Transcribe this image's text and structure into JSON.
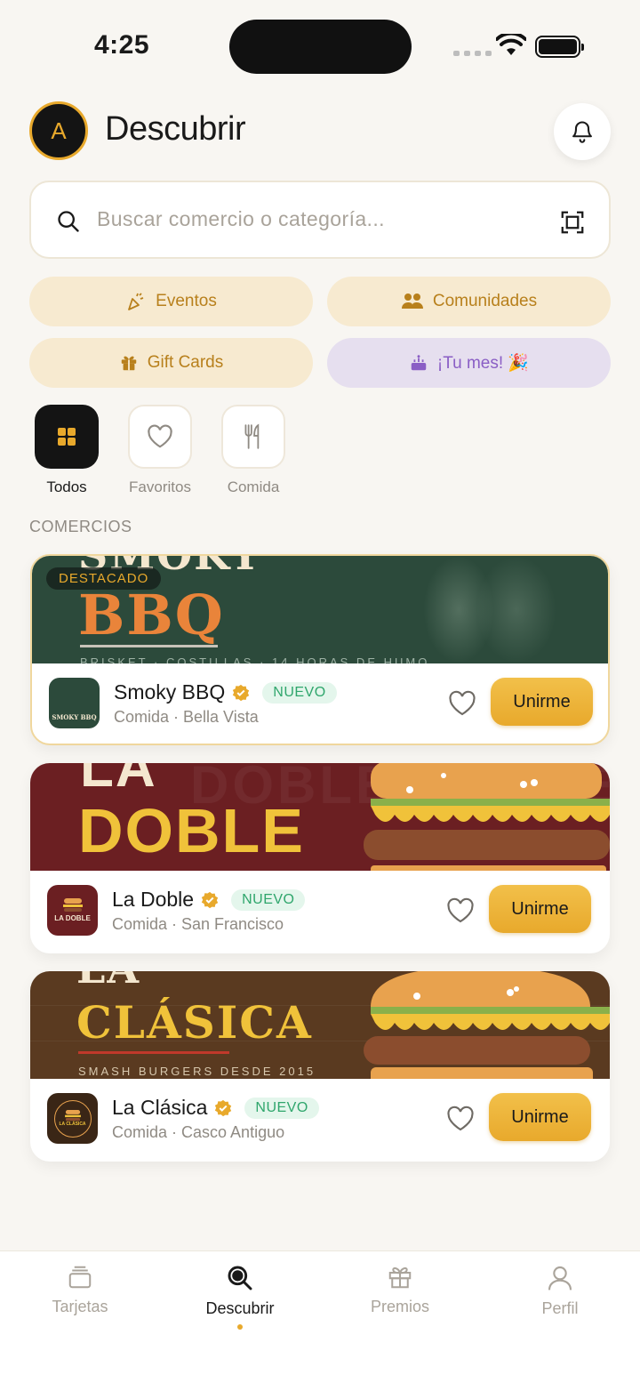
{
  "status_bar": {
    "time": "4:25"
  },
  "header": {
    "avatar_letter": "A",
    "title": "Descubrir"
  },
  "search": {
    "placeholder": "Buscar comercio o categoría..."
  },
  "quick_actions": [
    {
      "label": "Eventos",
      "icon": "party-popper-icon"
    },
    {
      "label": "Comunidades",
      "icon": "community-icon"
    },
    {
      "label": "Gift Cards",
      "icon": "gift-icon"
    },
    {
      "label": "¡Tu mes! 🎉",
      "icon": "cake-icon"
    }
  ],
  "categories": [
    {
      "label": "Todos",
      "icon": "grid-icon",
      "selected": true
    },
    {
      "label": "Favoritos",
      "icon": "heart-icon",
      "selected": false
    },
    {
      "label": "Comida",
      "icon": "utensils-icon",
      "selected": false
    }
  ],
  "section_title": "COMERCIOS",
  "merchants": [
    {
      "name": "Smoky BBQ",
      "badge": "NUEVO",
      "subtitle": "Comida · Bella Vista",
      "join_label": "Unirme",
      "featured_label": "DESTACADO",
      "banner_big": "BBQ",
      "banner_top": "SMOKY",
      "banner_small": "BRISKET · COSTILLAS · 14 HORAS DE HUMO",
      "logo_text": "SMOKY BBQ"
    },
    {
      "name": "La Doble",
      "badge": "NUEVO",
      "subtitle": "Comida · San Francisco",
      "join_label": "Unirme",
      "banner_big": "DOBLE",
      "banner_top": "LA",
      "logo_text": "LA DOBLE"
    },
    {
      "name": "La Clásica",
      "badge": "NUEVO",
      "subtitle": "Comida · Casco Antiguo",
      "join_label": "Unirme",
      "banner_big": "CLÁSICA",
      "banner_top": "LA",
      "banner_small": "SMASH BURGERS DESDE 2015",
      "logo_text": "LA CLÁSICA"
    }
  ],
  "tabs": [
    {
      "label": "Tarjetas",
      "icon": "cards-icon",
      "active": false
    },
    {
      "label": "Descubrir",
      "icon": "search-icon",
      "active": true
    },
    {
      "label": "Premios",
      "icon": "gift-icon",
      "active": false
    },
    {
      "label": "Perfil",
      "icon": "user-icon",
      "active": false
    }
  ],
  "colors": {
    "accent": "#e8a92c",
    "background": "#f8f6f2",
    "badge_green": "#2fa66c",
    "lilac": "#8a5ec5"
  }
}
